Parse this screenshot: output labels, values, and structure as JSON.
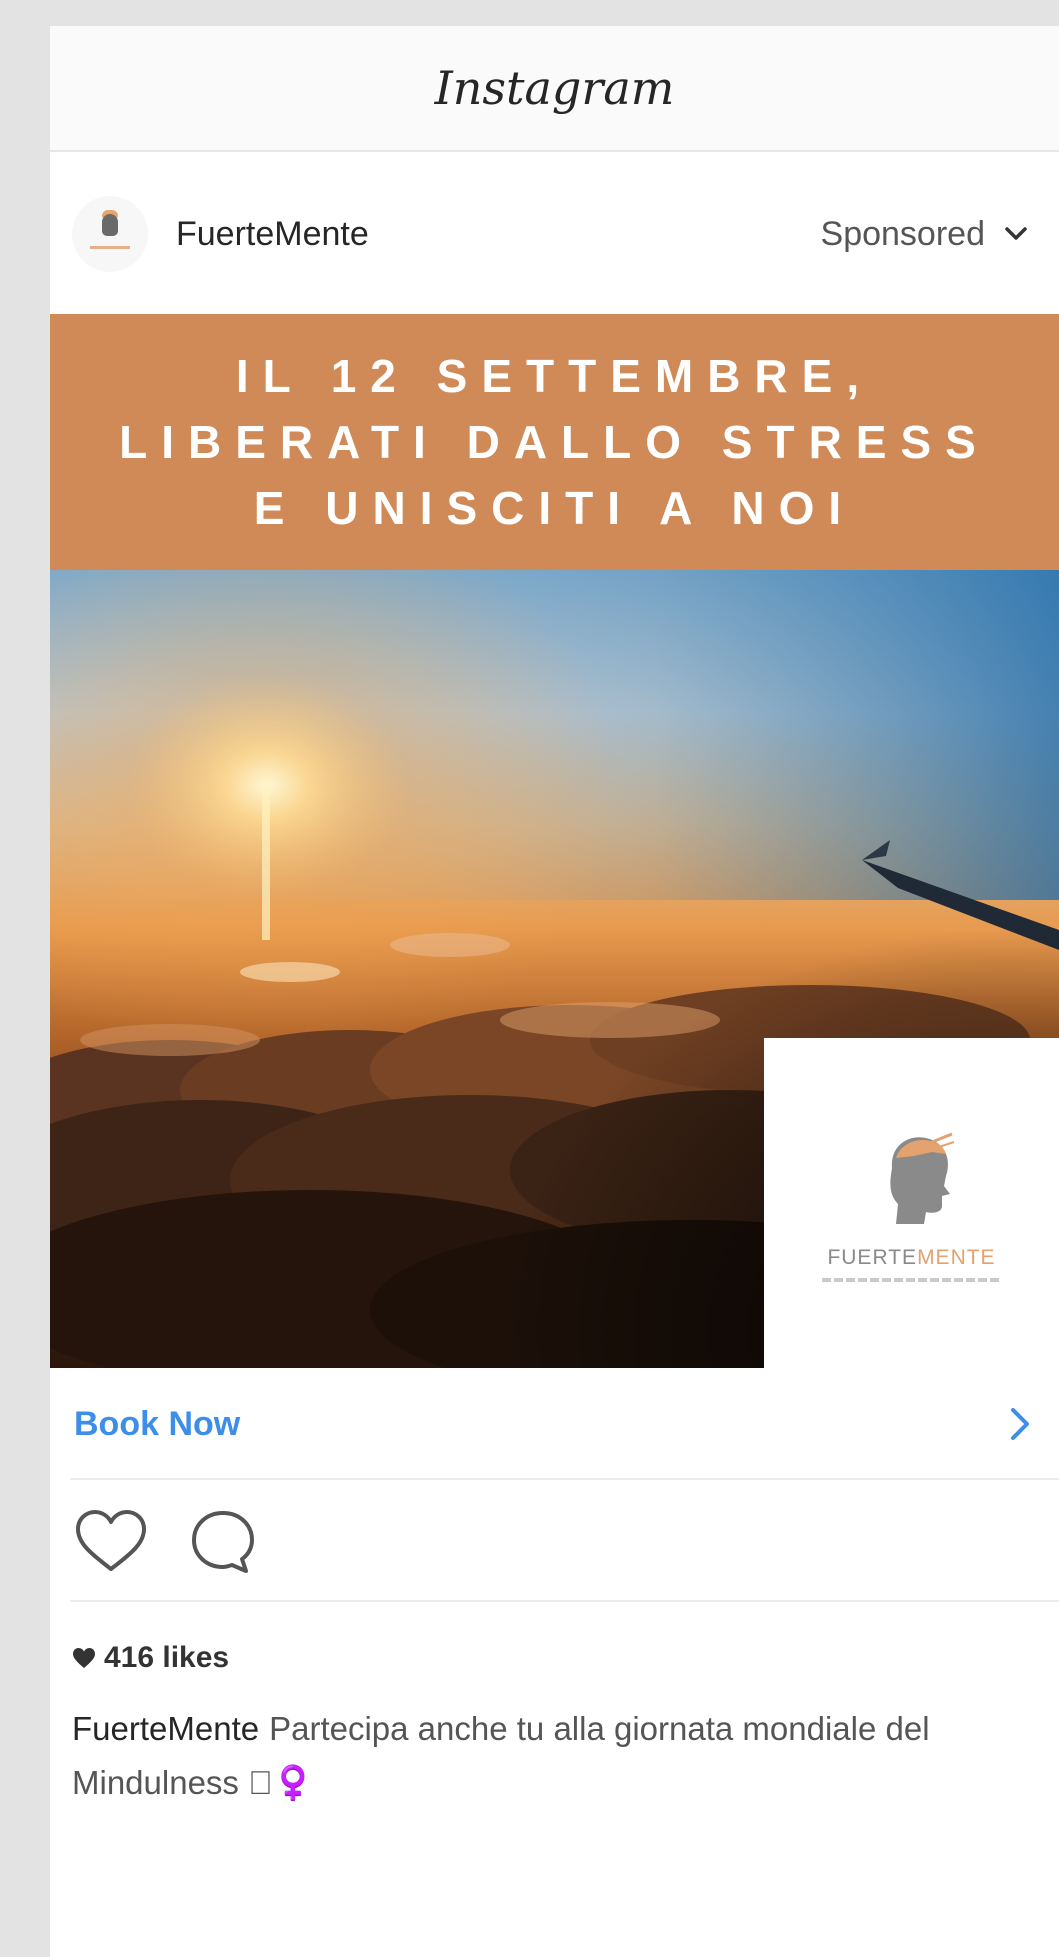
{
  "app": {
    "brand": "Instagram"
  },
  "post": {
    "username": "FuerteMente",
    "sponsored_label": "Sponsored",
    "banner_lines": [
      "IL 12 SETTEMBRE,",
      "LIBERATI DALLO STRESS",
      "E UNISCITI A NOI"
    ],
    "logo": {
      "text_part1": "FUERTE",
      "text_part2": "MENTE"
    },
    "cta_label": "Book Now",
    "likes_text": "416 likes",
    "caption_user": "FuerteMente",
    "caption_text": "Partecipa anche tu alla giornata mondiale del Mindulness 🏻‍♀️"
  },
  "icons": {
    "sponsored_chevron": "chevron-down-icon",
    "cta_chevron": "chevron-right-icon",
    "like": "heart-icon",
    "comment": "comment-icon",
    "likes_heart": "heart-filled-icon"
  },
  "colors": {
    "banner": "#d08a57",
    "cta": "#3d8ee8",
    "logo_accent": "#e3a26e"
  }
}
